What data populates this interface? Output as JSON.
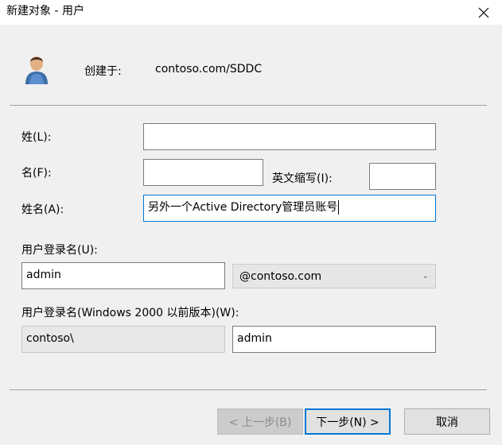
{
  "window": {
    "title": "新建对象 - 用户"
  },
  "header": {
    "created_in_label": "创建于:",
    "created_in_value": "contoso.com/SDDC"
  },
  "form": {
    "last_name_label": "姓(L):",
    "last_name_value": "",
    "first_name_label": "名(F):",
    "first_name_value": "",
    "initials_label": "英文缩写(I):",
    "initials_value": "",
    "full_name_label": "姓名(A):",
    "full_name_value": "另外一个Active Directory管理员账号",
    "logon_name_label": "用户登录名(U):",
    "logon_name_value": "admin",
    "upn_suffix_value": "@contoso.com",
    "pre2000_label": "用户登录名(Windows 2000 以前版本)(W):",
    "pre2000_domain_value": "contoso\\",
    "pre2000_name_value": "admin"
  },
  "buttons": {
    "back": "< 上一步(B)",
    "next": "下一步(N) >",
    "cancel": "取消"
  },
  "icons": {
    "user": "user-icon",
    "close": "close-icon",
    "dropdown": "chevron-down-icon"
  }
}
